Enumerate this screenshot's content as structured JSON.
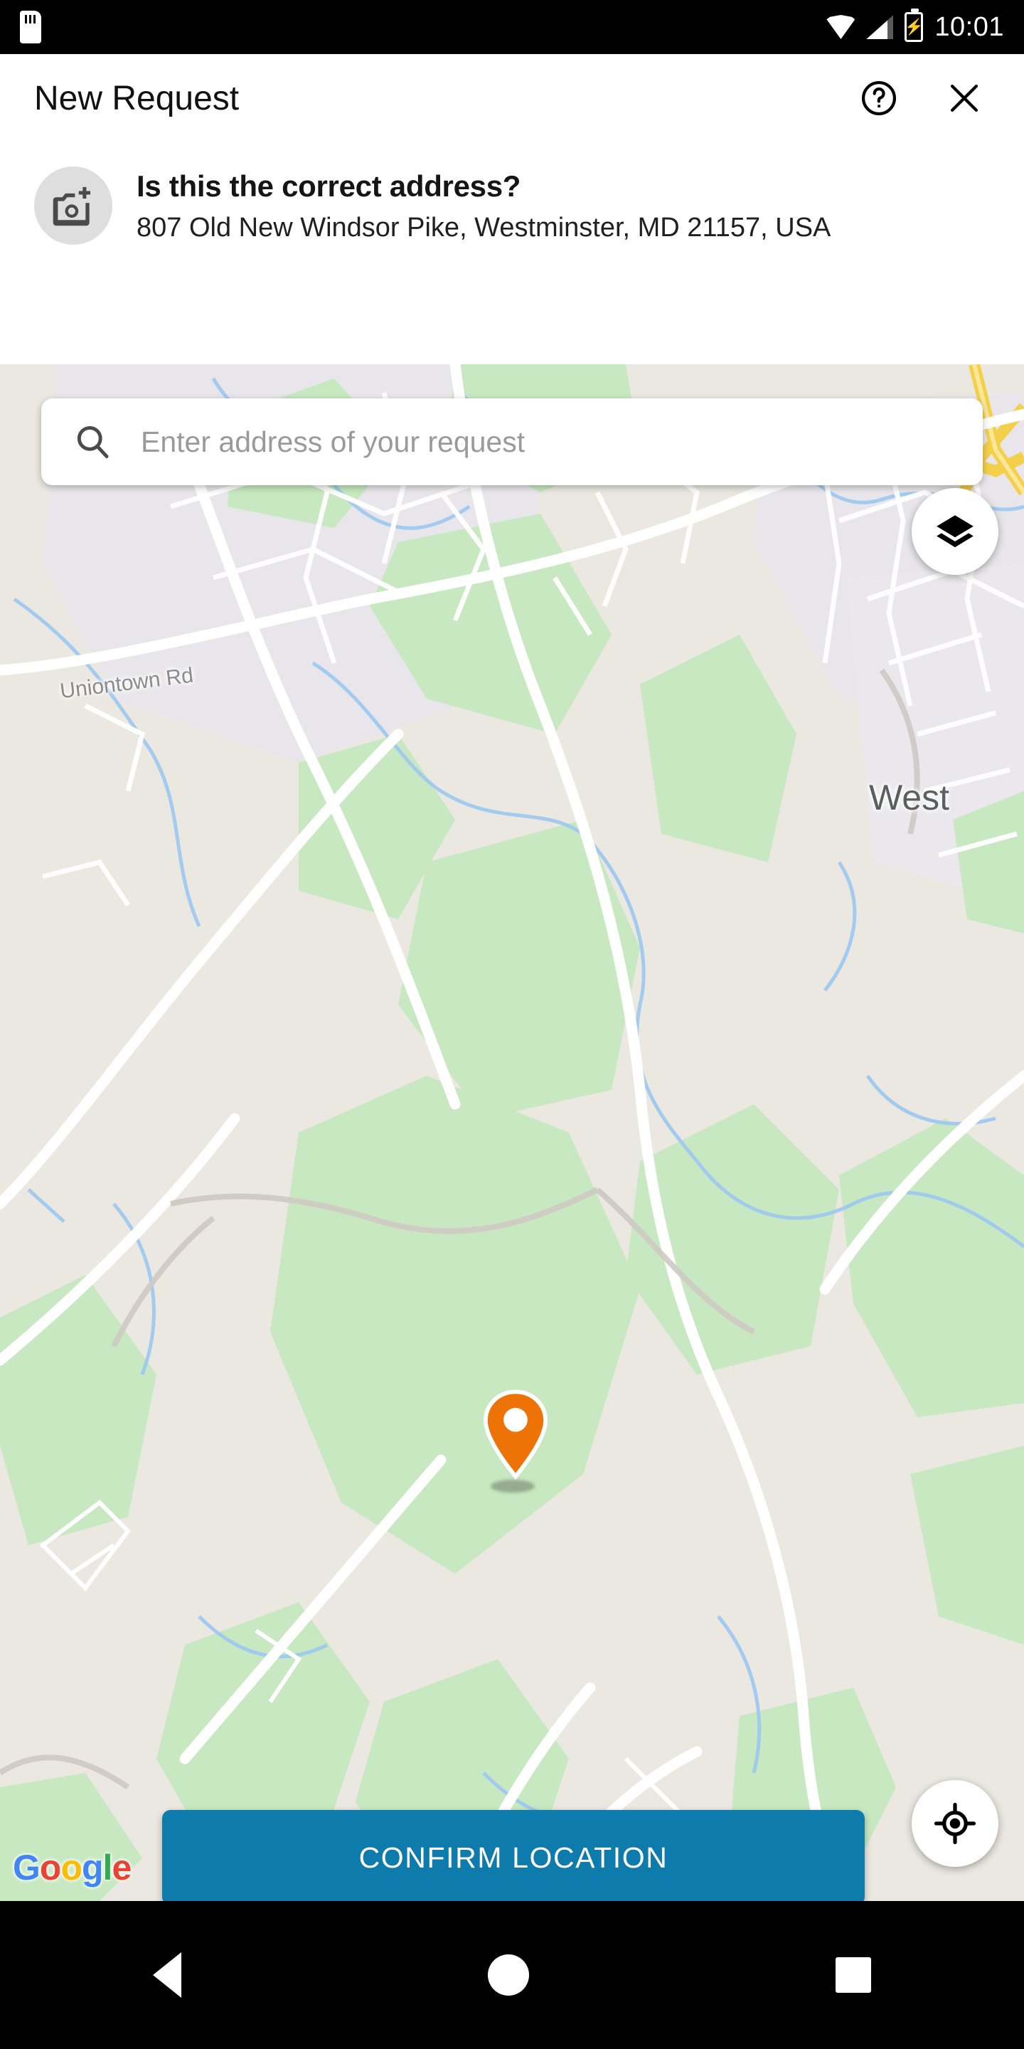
{
  "statusbar": {
    "time": "10:01",
    "icons": [
      "sd-card-icon",
      "wifi-icon",
      "cellular-signal-icon",
      "battery-charging-icon"
    ]
  },
  "appbar": {
    "title": "New Request",
    "help_icon": "help-circle-icon",
    "close_icon": "close-icon"
  },
  "prompt": {
    "avatar_icon": "add-a-photo-icon",
    "title": "Is this the correct address?",
    "address": "807 Old New Windsor Pike, Westminster, MD 21157, USA"
  },
  "map": {
    "search": {
      "placeholder": "Enter address of your request",
      "value": "",
      "icon": "search-icon"
    },
    "layers_button_icon": "map-layers-icon",
    "locate_button_icon": "my-location-icon",
    "marker_icon": "location-pin-marker",
    "labels": {
      "road": "Uniontown Rd",
      "city": "West"
    },
    "attribution": {
      "g1": "G",
      "o1": "o",
      "o2": "o",
      "g2": "g",
      "l": "l",
      "e": "e"
    },
    "colors": {
      "land": "#ebe7e1",
      "park": "#c7e8c0",
      "road": "#ffffff",
      "highway": "#f4d04a",
      "water": "#9fc9ef",
      "marker": "#ee7307",
      "urban": "#e8e6ea"
    }
  },
  "confirm": {
    "label": "CONFIRM LOCATION",
    "color": "#0d7bab"
  },
  "navbar": {
    "back_icon": "nav-back-icon",
    "home_icon": "nav-home-icon",
    "recents_icon": "nav-recents-icon"
  }
}
